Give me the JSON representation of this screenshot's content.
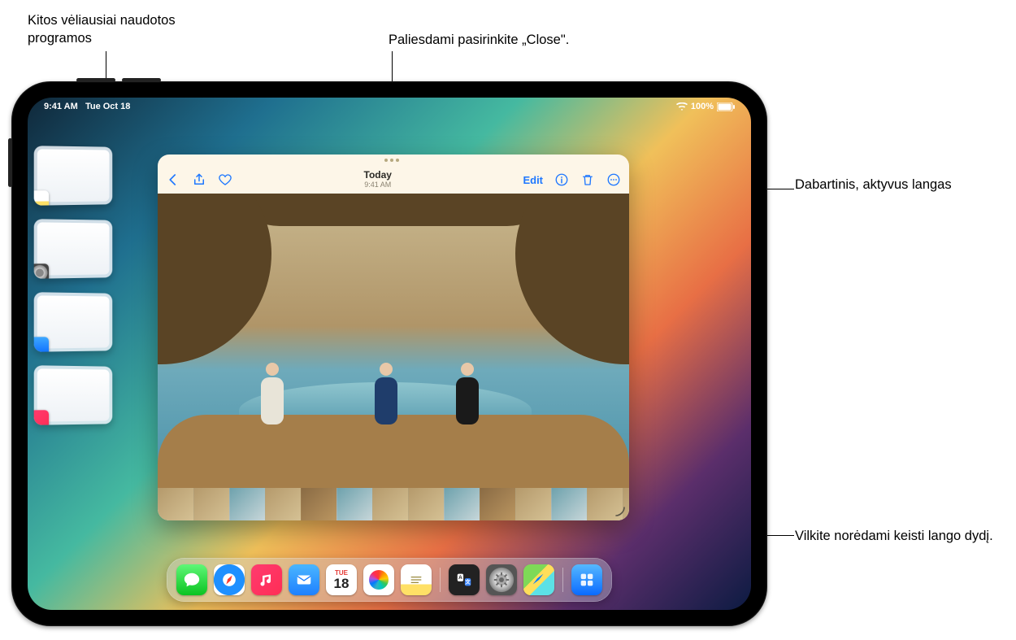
{
  "status": {
    "time": "9:41 AM",
    "date": "Tue Oct 18",
    "battery": "100%"
  },
  "window": {
    "title_main": "Today",
    "title_sub": "9:41 AM",
    "edit_label": "Edit"
  },
  "dock": {
    "calendar_day_label": "TUE",
    "calendar_day_number": "18"
  },
  "callouts": {
    "recents": "Kitos vėliausiai naudotos programos",
    "close": "Paliesdami pasirinkite „Close\".",
    "active": "Dabartinis, aktyvus langas",
    "resize": "Vilkite norėdami keisti lango dydį."
  }
}
